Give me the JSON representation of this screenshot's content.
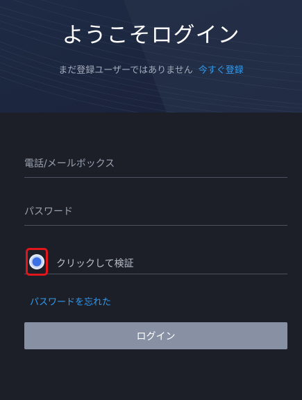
{
  "header": {
    "title": "ようこそログイン",
    "no_account_text": "まだ登録ユーザーではありません",
    "register_link": "今すぐ登録"
  },
  "form": {
    "phone_email_placeholder": "電話/メールボックス",
    "password_placeholder": "パスワード",
    "verify_label": "クリックして検証",
    "forgot_password": "パスワードを忘れた",
    "login_button": "ログイン"
  },
  "colors": {
    "link": "#2f9bf0",
    "button": "#8791a3",
    "background": "#1c1f28",
    "highlight_box": "#e0161b"
  },
  "icons": {
    "verify": "verify-circle-icon"
  }
}
